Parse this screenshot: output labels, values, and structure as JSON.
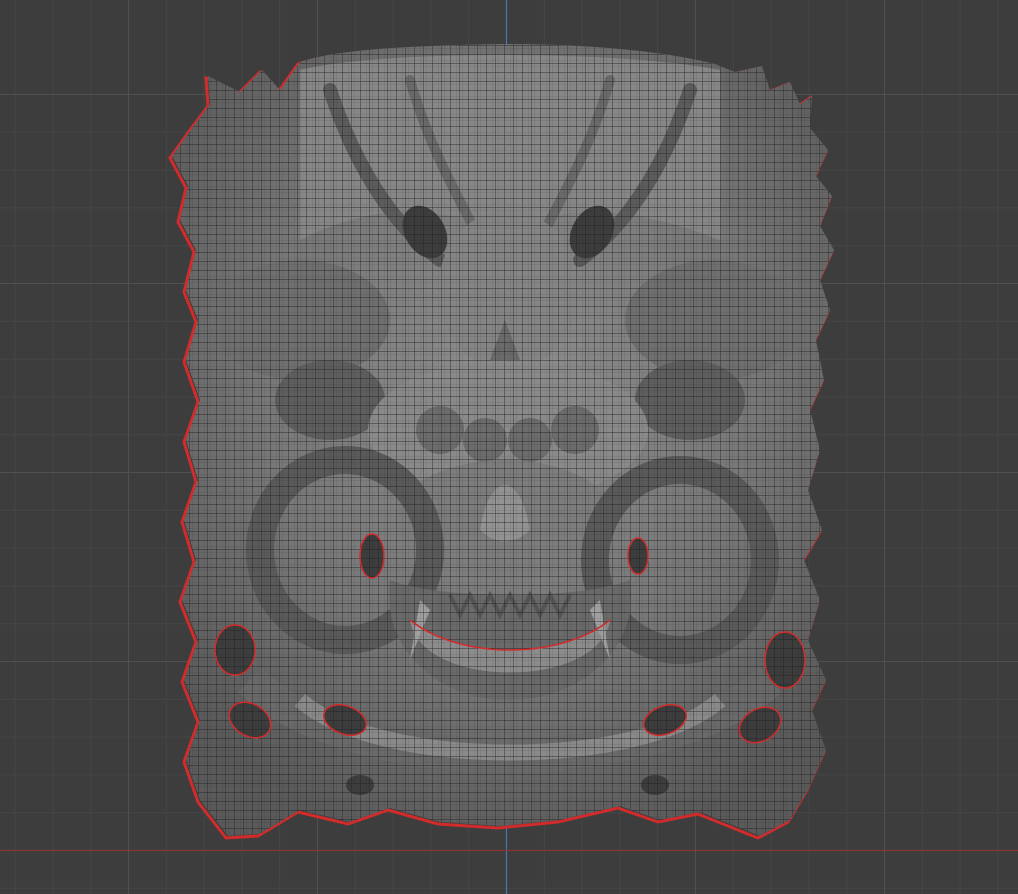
{
  "viewport": {
    "background_color": "#3d3d3d",
    "grid_minor_color": "#464646",
    "grid_major_color": "#505050",
    "axis_y_color": "#4a76b3",
    "axis_x_color": "#8a3434",
    "mesh_fill_color": "#7a7a7a",
    "mesh_wire_color": "#1e1e1e",
    "mesh_highlight_color": "#9c9c9c",
    "mesh_shadow_color": "#4d4d4d",
    "outline_color": "#d12b2b",
    "object_name_icon": "demon-mask-mesh-icon"
  }
}
